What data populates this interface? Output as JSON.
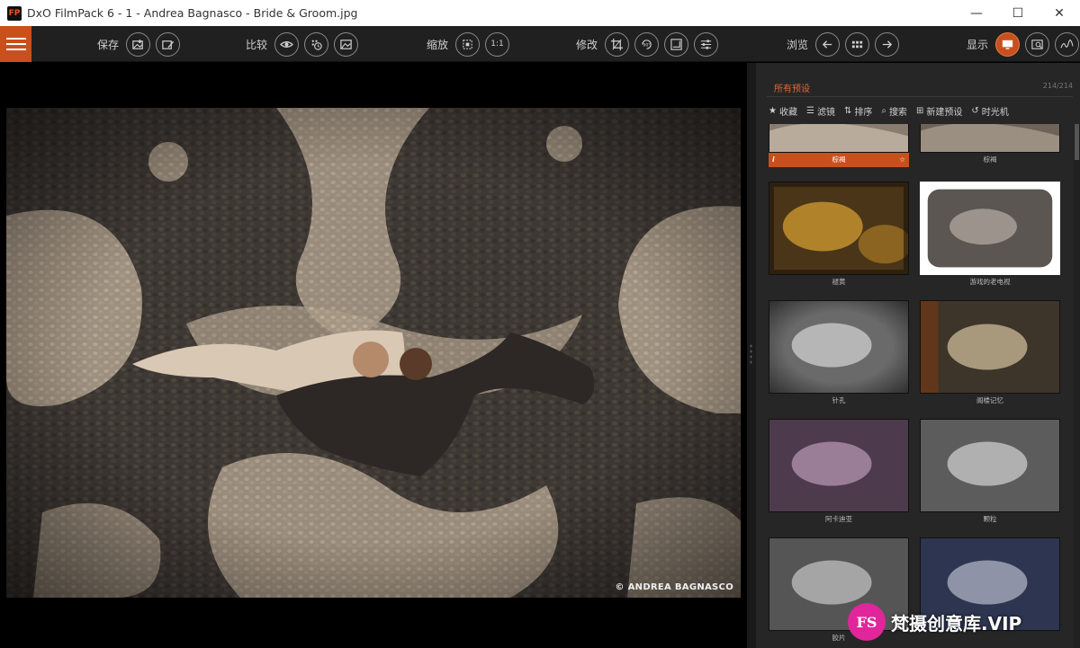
{
  "window": {
    "logo_text": "FP",
    "title": "DxO FilmPack 6 - 1 - Andrea Bagnasco - Bride & Groom.jpg",
    "minimize": "—",
    "maximize": "☐",
    "close": "✕"
  },
  "toolbar": {
    "save_label": "保存",
    "compare_label": "比较",
    "zoom_label": "缩放",
    "zoom_100": "1:1",
    "edit_label": "修改",
    "rotate_label": "90°",
    "browse_label": "浏览",
    "display_label": "显示"
  },
  "viewer": {
    "watermark": "© ANDREA BAGNASCO"
  },
  "presets": {
    "title": "所有预设",
    "count": "214/214",
    "tools": [
      {
        "icon": "★",
        "label": "收藏"
      },
      {
        "icon": "☰",
        "label": "滤镜"
      },
      {
        "icon": "⇅",
        "label": "排序"
      },
      {
        "icon": "⌕",
        "label": "搜索"
      },
      {
        "icon": "⊞",
        "label": "新建预设"
      },
      {
        "icon": "↺",
        "label": "时光机"
      }
    ],
    "items": [
      {
        "label": "棕褐",
        "selected": true,
        "info": "i",
        "star": "☆"
      },
      {
        "label": "棕褐"
      },
      {
        "label": "褪黄"
      },
      {
        "label": "游戏的老电视"
      },
      {
        "label": "针孔"
      },
      {
        "label": "阁楼记忆"
      },
      {
        "label": "阿卡迪亚"
      },
      {
        "label": "颗粒"
      },
      {
        "label": "胶片"
      },
      {
        "label": ""
      }
    ]
  },
  "brand": {
    "badge": "FS",
    "text": "梵摄创意库.VIP"
  },
  "colors": {
    "accent": "#c9501c",
    "panel": "#262626",
    "toolbar": "#202020"
  }
}
